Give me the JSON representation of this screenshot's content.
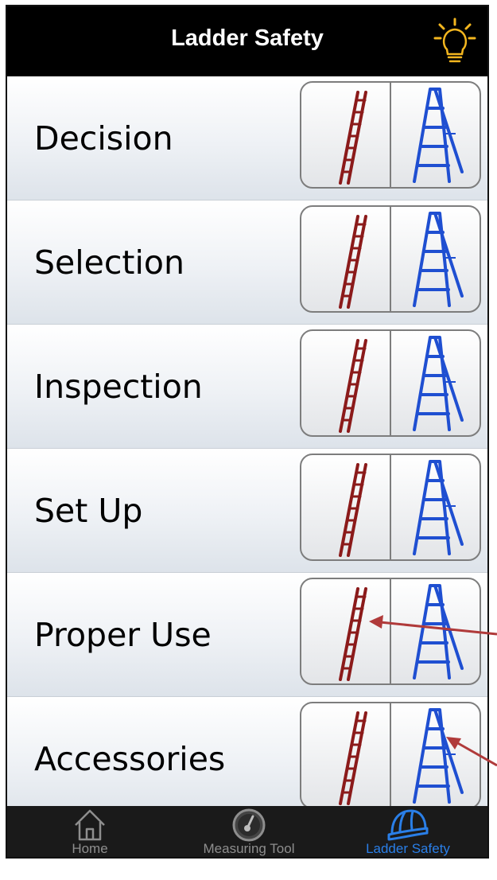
{
  "navbar": {
    "title": "Ladder Safety",
    "action_icon": "lightbulb-icon"
  },
  "rows": [
    {
      "label": "Decision"
    },
    {
      "label": "Selection"
    },
    {
      "label": "Inspection"
    },
    {
      "label": "Set Up"
    },
    {
      "label": "Proper Use"
    },
    {
      "label": "Accessories"
    }
  ],
  "segment_icons": {
    "left": "extension-ladder-icon",
    "right": "step-ladder-icon"
  },
  "tabs": [
    {
      "label": "Home",
      "icon": "home-icon",
      "active": false
    },
    {
      "label": "Measuring Tool",
      "icon": "gauge-icon",
      "active": false
    },
    {
      "label": "Ladder Safety",
      "icon": "hard-hat-icon",
      "active": true
    }
  ],
  "colors": {
    "extension_ladder": "#8b1a1a",
    "step_ladder": "#1f4fd1",
    "tab_active": "#2a7fe8",
    "annotation_arrow": "#b03a3a"
  }
}
